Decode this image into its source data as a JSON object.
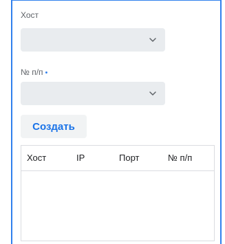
{
  "form": {
    "host_label": "Хост",
    "host_value": "",
    "order_label": "№ п/п",
    "order_required_mark": "•",
    "order_value": "",
    "create_label": "Создать"
  },
  "table": {
    "columns": [
      "Хост",
      "IP",
      "Порт",
      "№ п/п"
    ],
    "rows": []
  },
  "icons": {
    "select_arrow": "chevron-down-icon"
  },
  "colors": {
    "accent": "#1a73e8",
    "frame_border": "#2f80ed",
    "field_bg": "#e9ecef"
  }
}
